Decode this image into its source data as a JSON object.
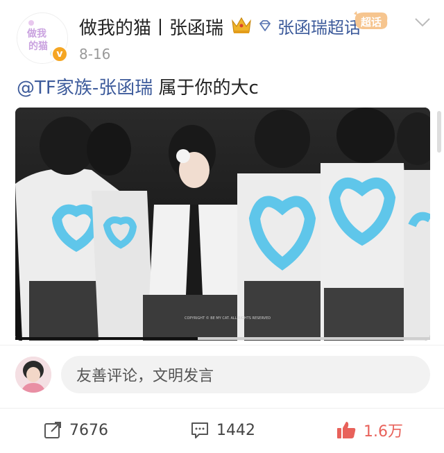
{
  "post": {
    "username": "做我的猫丨张函瑞",
    "super_topic": "张函瑞超话",
    "super_badge": "超话",
    "date": "8-16",
    "mention": "@TF家族-张函瑞",
    "text": " 属于你的大c",
    "avatar_text": "做我的猫",
    "verified_badge": "v"
  },
  "video": {
    "watermark": "COPYRIGHT © BE MY CAT. ALL RIGHTS RESERVED",
    "progress": 0.44
  },
  "comment": {
    "placeholder": "友善评论，文明发言"
  },
  "actions": {
    "repost_count": "7676",
    "comment_count": "1442",
    "like_count": "1.6万"
  },
  "colors": {
    "link": "#3d5b9b",
    "like": "#e8615a",
    "verified": "#f5a623"
  },
  "icons": [
    "crown-icon",
    "diamond-icon",
    "chevron-down-icon",
    "repost-icon",
    "comment-icon",
    "like-icon"
  ]
}
